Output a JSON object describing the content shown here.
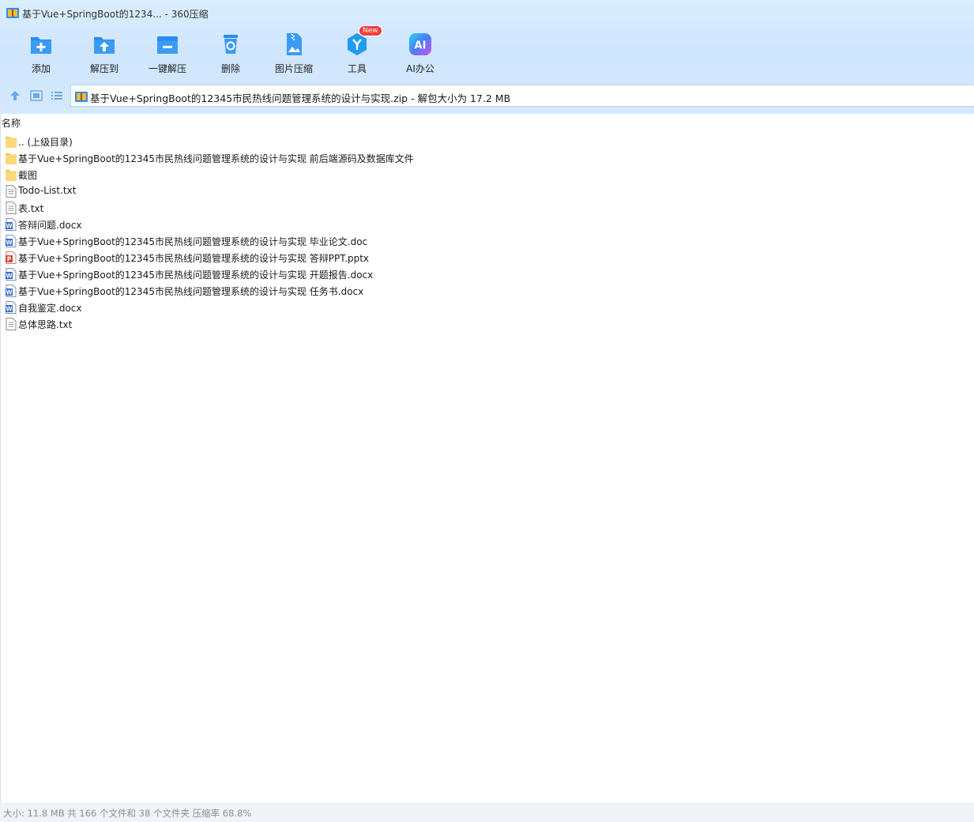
{
  "window": {
    "title": "基于Vue+SpringBoot的1234... - 360压缩",
    "app_icon": "zip-archive-icon"
  },
  "toolbar": [
    {
      "label": "添加",
      "icon": "add-icon"
    },
    {
      "label": "解压到",
      "icon": "extract-to-icon"
    },
    {
      "label": "一键解压",
      "icon": "quick-extract-icon"
    },
    {
      "label": "删除",
      "icon": "delete-icon"
    },
    {
      "label": "图片压缩",
      "icon": "image-compress-icon"
    },
    {
      "label": "工具",
      "icon": "tools-icon",
      "badge": "New"
    },
    {
      "label": "AI办公",
      "icon": "ai-office-icon"
    }
  ],
  "nav": {
    "address": "基于Vue+SpringBoot的12345市民热线问题管理系统的设计与实现.zip - 解包大小为 17.2 MB"
  },
  "list": {
    "column_name": "名称",
    "items": [
      {
        "name": ".. (上级目录)",
        "type": "folder"
      },
      {
        "name": "基于Vue+SpringBoot的12345市民热线问题管理系统的设计与实现 前后端源码及数据库文件",
        "type": "folder"
      },
      {
        "name": "截图",
        "type": "folder"
      },
      {
        "name": "Todo-List.txt",
        "type": "txt"
      },
      {
        "name": "表.txt",
        "type": "txt"
      },
      {
        "name": "答辩问题.docx",
        "type": "word"
      },
      {
        "name": "基于Vue+SpringBoot的12345市民热线问题管理系统的设计与实现 毕业论文.doc",
        "type": "word"
      },
      {
        "name": "基于Vue+SpringBoot的12345市民热线问题管理系统的设计与实现 答辩PPT.pptx",
        "type": "ppt"
      },
      {
        "name": "基于Vue+SpringBoot的12345市民热线问题管理系统的设计与实现 开题报告.docx",
        "type": "word"
      },
      {
        "name": "基于Vue+SpringBoot的12345市民热线问题管理系统的设计与实现 任务书.docx",
        "type": "word"
      },
      {
        "name": "自我鉴定.docx",
        "type": "word"
      },
      {
        "name": "总体思路.txt",
        "type": "txt"
      }
    ]
  },
  "status": {
    "text": "大小: 11.8 MB 共 166 个文件和 38 个文件夹 压缩率 68.8%"
  },
  "colors": {
    "accent": "#2a8cf0",
    "folder": "#f9d26e",
    "word": "#2b63c8",
    "ppt": "#d04a2a",
    "badge": "#f53b3b"
  }
}
